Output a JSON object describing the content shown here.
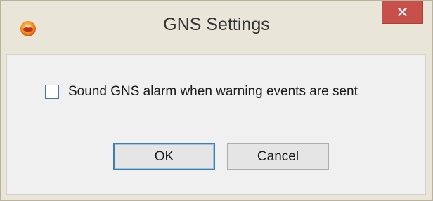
{
  "window": {
    "title": "GNS Settings",
    "close_glyph": "✕",
    "app_icon": "app-logo-icon"
  },
  "options": {
    "sound_alarm_label": "Sound GNS alarm when warning events are sent",
    "sound_alarm_checked": false
  },
  "buttons": {
    "ok_label": "OK",
    "cancel_label": "Cancel"
  },
  "colors": {
    "close_button": "#c7504a",
    "frame": "#e9e5d8",
    "client": "#f0f0f0",
    "default_button_border": "#3c7fb1"
  }
}
